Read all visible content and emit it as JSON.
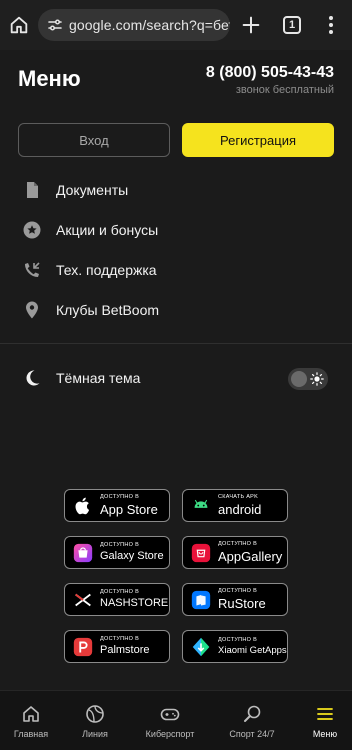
{
  "browser": {
    "url": "google.com/search?q=бетбумв",
    "tab_count": "1"
  },
  "header": {
    "title": "Меню",
    "phone": "8 (800) 505-43-43",
    "phone_note": "звонок бесплатный"
  },
  "auth": {
    "login_label": "Вход",
    "register_label": "Регистрация"
  },
  "menu": {
    "items": [
      {
        "label": "Документы",
        "icon": "document-icon"
      },
      {
        "label": "Акции и бонусы",
        "icon": "star-badge-icon"
      },
      {
        "label": "Тех. поддержка",
        "icon": "phone-support-icon"
      },
      {
        "label": "Клубы BetBoom",
        "icon": "location-pin-icon"
      }
    ]
  },
  "theme": {
    "label": "Тёмная тема",
    "enabled": false
  },
  "stores": [
    {
      "small": "Доступно в",
      "name": "App Store",
      "icon": "apple-icon"
    },
    {
      "small": "Скачать APK",
      "name": "android",
      "icon": "android-icon"
    },
    {
      "small": "Доступно в",
      "name": "Galaxy Store",
      "icon": "galaxy-store-icon"
    },
    {
      "small": "Доступно в",
      "name": "AppGallery",
      "icon": "huawei-icon"
    },
    {
      "small": "Доступно в",
      "name": "NASHSTORE",
      "icon": "nashstore-icon"
    },
    {
      "small": "Доступно в",
      "name": "RuStore",
      "icon": "rustore-icon"
    },
    {
      "small": "Доступно в",
      "name": "Palmstore",
      "icon": "palmstore-icon"
    },
    {
      "small": "Доступно в",
      "name": "Xiaomi GetApps",
      "icon": "xiaomi-getapps-icon"
    }
  ],
  "bottom_nav": {
    "items": [
      {
        "label": "Главная",
        "icon": "home-icon"
      },
      {
        "label": "Линия",
        "icon": "ball-icon"
      },
      {
        "label": "Киберспорт",
        "icon": "gamepad-icon"
      },
      {
        "label": "Спорт 24/7",
        "icon": "racket-icon"
      },
      {
        "label": "Меню",
        "icon": "menu-icon",
        "active": true
      }
    ]
  },
  "colors": {
    "accent": "#f5e31e",
    "background": "#1b1b1b"
  }
}
